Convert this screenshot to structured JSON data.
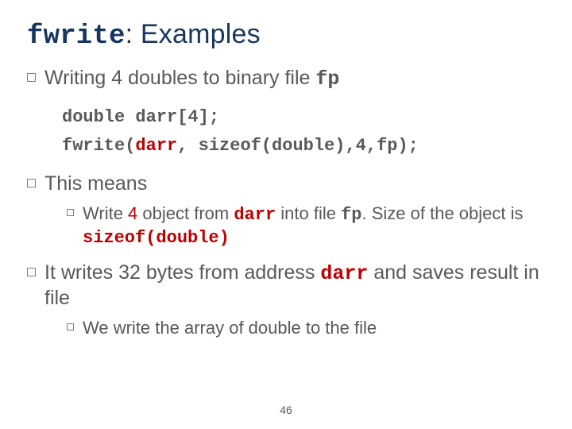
{
  "title": {
    "code": "fwrite",
    "rest": ": Examples"
  },
  "bul1": {
    "pre": "Writing 4 doubles to binary file ",
    "fp": "fp"
  },
  "code": {
    "line1": "double darr[4];",
    "l2a": "fwrite(",
    "l2darr": "darr",
    "l2b": ", sizeof(double),4,fp);"
  },
  "bul2": {
    "text": "This means",
    "sub": {
      "a": "Write ",
      "four": "4",
      "b": " object from ",
      "darr": "darr",
      "c": " into file ",
      "fp": "fp",
      "d": ". Size of the object is ",
      "sod": "sizeof(double)"
    }
  },
  "bul3": {
    "a": "It writes 32 bytes from address ",
    "darr": "darr",
    "b": " and saves result in file",
    "sub": "We write the array of double to the file"
  },
  "page": "46"
}
